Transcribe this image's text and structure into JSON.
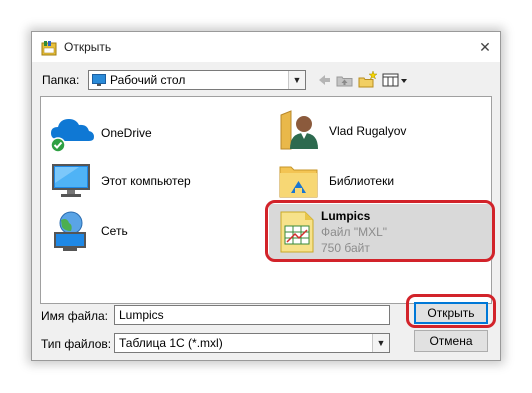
{
  "window": {
    "title": "Открыть",
    "close_glyph": "✕"
  },
  "folder_bar": {
    "label": "Папка:",
    "current_folder": "Рабочий стол",
    "toolbar_icons": [
      "back-arrow-icon",
      "up-folder-icon",
      "new-folder-icon",
      "view-menu-icon"
    ]
  },
  "items": [
    {
      "name": "OneDrive",
      "icon": "onedrive-icon"
    },
    {
      "name": "Vlad Rugalyov",
      "icon": "user-folder-icon"
    },
    {
      "name": "Этот компьютер",
      "icon": "computer-icon"
    },
    {
      "name": "Библиотеки",
      "icon": "libraries-icon"
    },
    {
      "name": "Сеть",
      "icon": "network-icon"
    }
  ],
  "selected_item": {
    "name": "Lumpics",
    "type": "Файл \"MXL\"",
    "size": "750 байт",
    "icon": "mxl-file-icon"
  },
  "filename": {
    "label": "Имя файла:",
    "value": "Lumpics"
  },
  "filetype": {
    "label": "Тип файлов:",
    "value": "Таблица 1С (*.mxl)"
  },
  "buttons": {
    "open": "Открыть",
    "cancel": "Отмена"
  },
  "colors": {
    "highlight_ring": "#d2232a",
    "selection_bg": "#d9d9d9",
    "default_button_border": "#0078d7"
  }
}
